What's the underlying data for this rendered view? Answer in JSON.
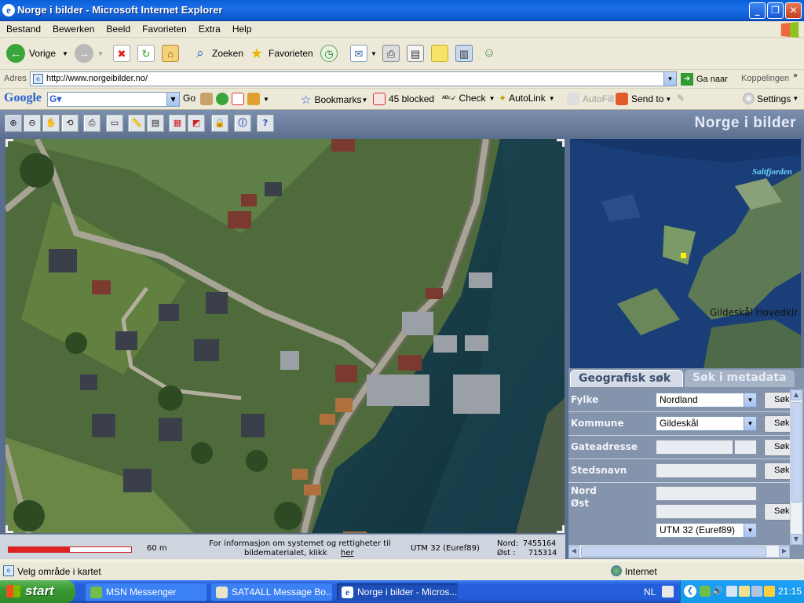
{
  "window": {
    "title": "Norge i bilder - Microsoft Internet Explorer"
  },
  "menu": [
    "Bestand",
    "Bewerken",
    "Beeld",
    "Favorieten",
    "Extra",
    "Help"
  ],
  "toolbar": {
    "back": "Vorige",
    "search": "Zoeken",
    "favorites": "Favorieten"
  },
  "address": {
    "label": "Adres",
    "url": "http://www.norgeibilder.no/",
    "go": "Ga naar",
    "links": "Koppelingen"
  },
  "google_toolbar": {
    "logo": "Google",
    "go": "Go",
    "bookmarks": "Bookmarks",
    "blocked": "45 blocked",
    "check": "Check",
    "autolink": "AutoLink",
    "autofill": "AutoFill",
    "sendto": "Send to",
    "settings": "Settings"
  },
  "app": {
    "title": "Norge i bilder",
    "overview_labels": {
      "fjord": "Saltfjorden",
      "place": "Gildeskål Hovedkir"
    },
    "info": {
      "scale": "60 m",
      "info_text_1": "For informasjon om systemet og rettigheter til",
      "info_text_2": "bildematerialet, klikk",
      "info_link": "her",
      "projection": "UTM 32 (Euref89)",
      "nord_label": "Nord:",
      "nord_value": "7455164",
      "ost_label": "Øst :",
      "ost_value": "715314"
    },
    "search": {
      "tab_active": "Geografisk søk",
      "tab_inactive": "Søk i metadata",
      "fylke_label": "Fylke",
      "fylke_value": "Nordland",
      "kommune_label": "Kommune",
      "kommune_value": "Gildeskål",
      "gate_label": "Gateadresse",
      "steds_label": "Stedsnavn",
      "nord_label": "Nord",
      "ost_label": "Øst",
      "projection_value": "UTM 32 (Euref89)",
      "search_button": "Søk"
    }
  },
  "statusbar": {
    "text": "Velg område i kartet",
    "zone": "Internet"
  },
  "taskbar": {
    "start": "start",
    "tasks": [
      "MSN Messenger",
      "SAT4ALL Message Bo...",
      "Norge i bilder - Micros..."
    ],
    "lang": "NL",
    "clock": "21:15"
  }
}
